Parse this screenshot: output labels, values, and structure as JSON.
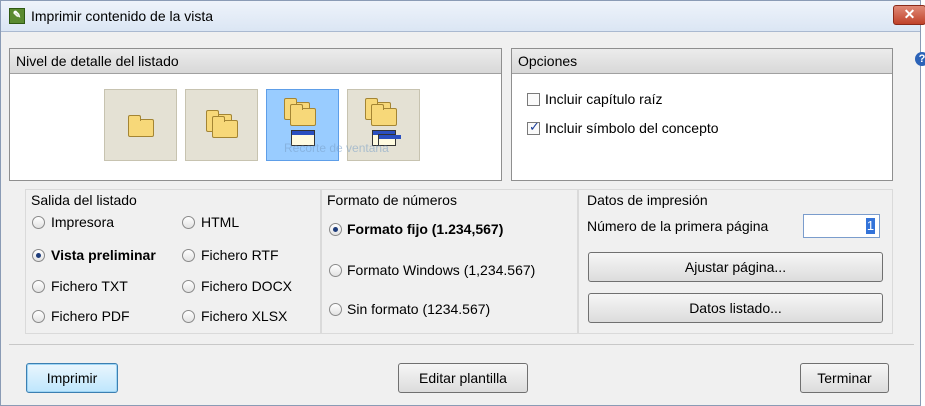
{
  "window": {
    "title": "Imprimir contenido de la vista"
  },
  "detail_panel": {
    "title": "Nivel de detalle del listado",
    "watermark": "Recorte de ventana",
    "selected_level": 3
  },
  "options_panel": {
    "title": "Opciones",
    "items": [
      {
        "label": "Incluir capítulo raíz",
        "checked": false
      },
      {
        "label": "Incluir símbolo del concepto",
        "checked": true
      }
    ]
  },
  "output_group": {
    "title": "Salida del listado",
    "options": [
      {
        "label": "Impresora",
        "selected": false
      },
      {
        "label": "HTML",
        "selected": false
      },
      {
        "label": "Vista preliminar",
        "selected": true
      },
      {
        "label": "Fichero RTF",
        "selected": false
      },
      {
        "label": "Fichero TXT",
        "selected": false
      },
      {
        "label": "Fichero DOCX",
        "selected": false
      },
      {
        "label": "Fichero PDF",
        "selected": false
      },
      {
        "label": "Fichero XLSX",
        "selected": false
      }
    ]
  },
  "number_format_group": {
    "title": "Formato de números",
    "options": [
      {
        "label": "Formato fijo (1.234,567)",
        "selected": true
      },
      {
        "label": "Formato Windows (1,234.567)",
        "selected": false
      },
      {
        "label": "Sin formato (1234.567)",
        "selected": false
      }
    ]
  },
  "print_data_group": {
    "title": "Datos de impresión",
    "first_page_label": "Número de la primera página",
    "first_page_value": "1",
    "adjust_page_label": "Ajustar página...",
    "list_data_label": "Datos listado..."
  },
  "footer": {
    "print_label": "Imprimir",
    "edit_template_label": "Editar plantilla",
    "finish_label": "Terminar"
  },
  "colors": {
    "selected_tile": "#99ccff",
    "tile": "#e4e1d4",
    "title_bar": "#dbe6f4"
  }
}
